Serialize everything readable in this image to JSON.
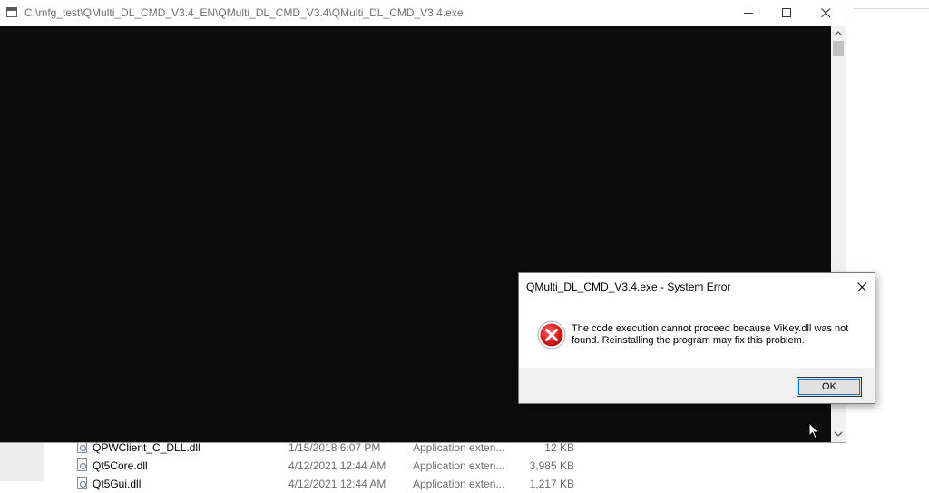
{
  "console_window": {
    "title": "C:\\mfg_test\\QMulti_DL_CMD_V3.4_EN\\QMulti_DL_CMD_V3.4\\QMulti_DL_CMD_V3.4.exe",
    "background_color": "#0c0c0c"
  },
  "error_dialog": {
    "title": "QMulti_DL_CMD_V3.4.exe - System Error",
    "icon": "error-icon",
    "message": "The code execution cannot proceed because ViKey.dll was not found. Reinstalling the program may fix this problem.",
    "ok_label": "OK"
  },
  "explorer": {
    "files": [
      {
        "name": "QPWClient_C_DLL.dll",
        "date": "1/15/2018 6:07 PM",
        "type": "Application exten...",
        "size": "12 KB"
      },
      {
        "name": "Qt5Core.dll",
        "date": "4/12/2021 12:44 AM",
        "type": "Application exten...",
        "size": "3,985 KB"
      },
      {
        "name": "Qt5Gui.dll",
        "date": "4/12/2021 12:44 AM",
        "type": "Application exten...",
        "size": "1,217 KB"
      }
    ]
  }
}
